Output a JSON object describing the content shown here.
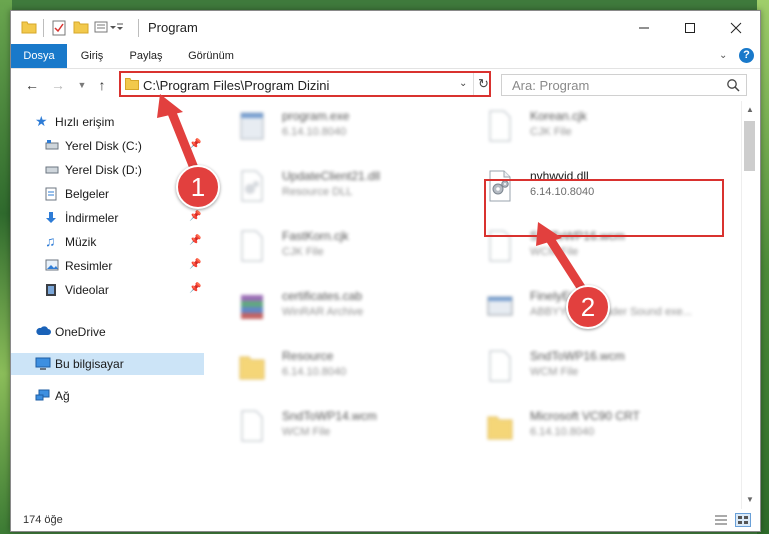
{
  "window": {
    "title": "Program"
  },
  "ribbon": {
    "tabs": [
      "Dosya",
      "Giriş",
      "Paylaş",
      "Görünüm"
    ],
    "active_tab": "Dosya"
  },
  "address": {
    "path": "C:\\Program Files\\Program Dizini"
  },
  "search": {
    "placeholder": "Ara: Program"
  },
  "sidebar": {
    "quick_access": "Hızlı erişim",
    "items": [
      {
        "label": "Yerel Disk (C:)",
        "pinned": true,
        "icon": "drive-icon"
      },
      {
        "label": "Yerel Disk (D:)",
        "pinned": false,
        "icon": "drive-icon"
      },
      {
        "label": "Belgeler",
        "pinned": true,
        "icon": "documents-icon"
      },
      {
        "label": "İndirmeler",
        "pinned": true,
        "icon": "downloads-icon"
      },
      {
        "label": "Müzik",
        "pinned": true,
        "icon": "music-icon"
      },
      {
        "label": "Resimler",
        "pinned": true,
        "icon": "pictures-icon"
      },
      {
        "label": "Videolar",
        "pinned": true,
        "icon": "videos-icon"
      }
    ],
    "onedrive": "OneDrive",
    "this_pc": "Bu bilgisayar",
    "network": "Ağ"
  },
  "files": [
    {
      "name": "program.exe",
      "sub": "6.14.10.8040",
      "icon": "exe-icon",
      "blurred": true
    },
    {
      "name": "Korean.cjk",
      "sub": "CJK File",
      "icon": "document-icon",
      "blurred": true
    },
    {
      "name": "UpdateClient21.dll",
      "sub": "Resource DLL",
      "icon": "dll-icon",
      "blurred": true
    },
    {
      "name": "nvhwvid.dll",
      "sub": "6.14.10.8040",
      "icon": "dll-icon",
      "blurred": false
    },
    {
      "name": "FastKorn.cjk",
      "sub": "CJK File",
      "icon": "document-icon",
      "blurred": true
    },
    {
      "name": "SndToWP16.wcm",
      "sub": "WCM File",
      "icon": "document-icon",
      "blurred": true
    },
    {
      "name": "certificates.cab",
      "sub": "WinRAR Archive",
      "icon": "archive-icon",
      "blurred": true
    },
    {
      "name": "FinelyEngine",
      "sub": "ABBYY FineReader Sound exe...",
      "icon": "app-icon",
      "blurred": true
    },
    {
      "name": "Resource",
      "sub": "6.14.10.8040",
      "icon": "folder-icon",
      "blurred": true
    },
    {
      "name": "SndToWP16.wcm",
      "sub": "WCM File",
      "icon": "document-icon",
      "blurred": true
    },
    {
      "name": "SndToWP14.wcm",
      "sub": "WCM File",
      "icon": "document-icon",
      "blurred": true
    },
    {
      "name": "Microsoft VC90 CRT",
      "sub": "6.14.10.8040",
      "icon": "folder-icon",
      "blurred": true
    }
  ],
  "status": {
    "count": "174 öğe"
  },
  "annotations": {
    "badge1": "1",
    "badge2": "2"
  },
  "colors": {
    "accent": "#1979ca",
    "highlight": "#d9322f",
    "selected": "#cce4f7"
  }
}
